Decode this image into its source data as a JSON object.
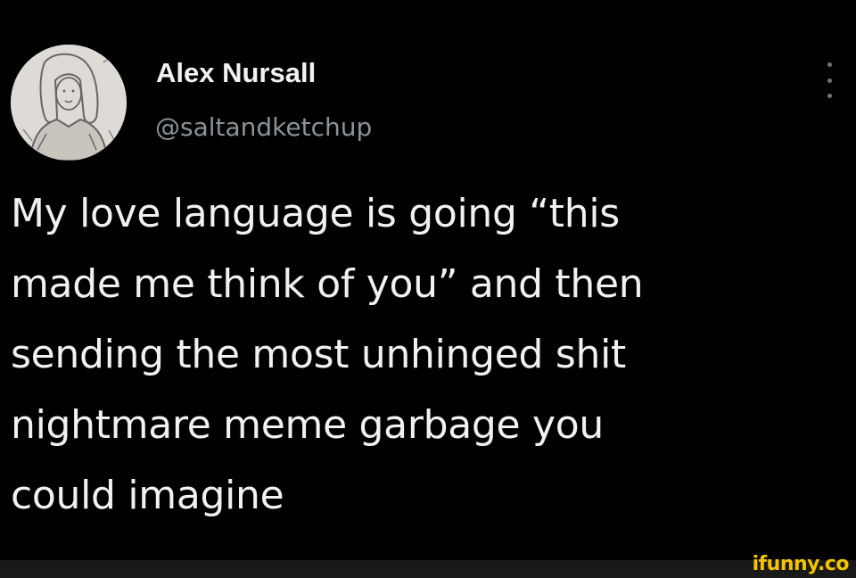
{
  "author": {
    "display_name": "Alex Nursall",
    "handle": "@saltandketchup"
  },
  "tweet": {
    "lines": [
      "My love language is going “this",
      "made me think of you” and then",
      "sending the most unhinged shit",
      "nightmare meme garbage you",
      "could imagine"
    ]
  },
  "icons": {
    "more": "more-options-icon",
    "avatar": "avatar-sketch"
  },
  "watermark": {
    "text": "ifunny.co"
  },
  "colors": {
    "background": "#000000",
    "text": "#f1f1f1",
    "handle": "#8b9298",
    "watermark": "#f5c400"
  }
}
